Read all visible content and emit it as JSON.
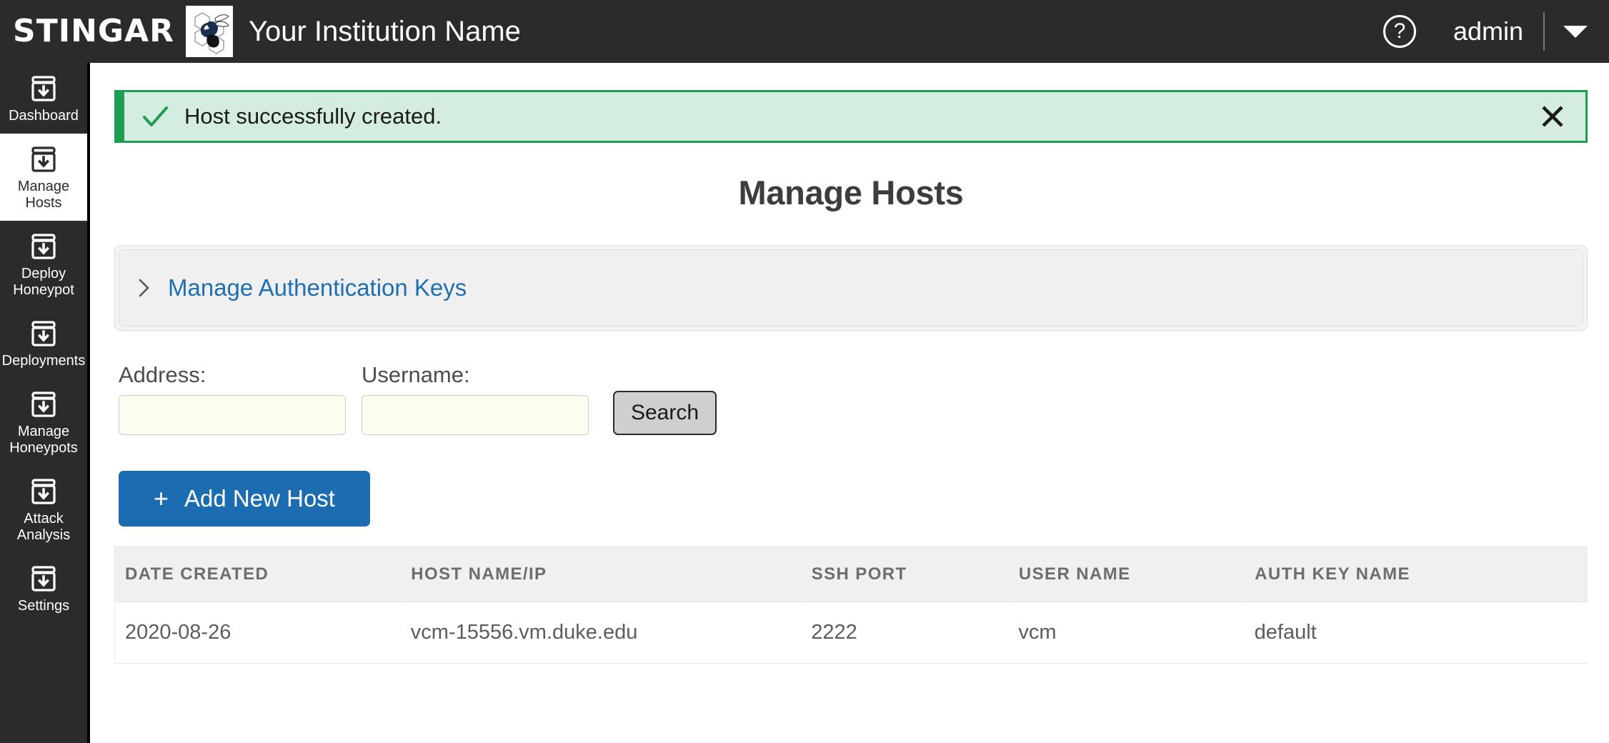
{
  "header": {
    "wordmark": "STINGAR",
    "logo_icon": "hornet-honeycomb-logo",
    "institution": "Your Institution Name",
    "help_icon": "question-mark-circle-icon",
    "user": "admin",
    "caret_icon": "chevron-down-icon",
    "bar_color": "#2b2b2b"
  },
  "sidebar": {
    "items": [
      {
        "label": "Dashboard",
        "icon": "archive-download-icon",
        "active": false
      },
      {
        "label": "Manage\nHosts",
        "icon": "archive-download-icon",
        "active": true
      },
      {
        "label": "Deploy\nHoneypot",
        "icon": "archive-download-icon",
        "active": false
      },
      {
        "label": "Deployments",
        "icon": "archive-download-icon",
        "active": false
      },
      {
        "label": "Manage\nHoneypots",
        "icon": "archive-download-icon",
        "active": false
      },
      {
        "label": "Attack\nAnalysis",
        "icon": "archive-download-icon",
        "active": false
      },
      {
        "label": "Settings",
        "icon": "archive-download-icon",
        "active": false
      }
    ]
  },
  "alert": {
    "message": "Host successfully created.",
    "icon": "check-mark-icon",
    "close_icon": "close-x-icon",
    "border_color": "#1e9e52",
    "background_color": "#d4ede0"
  },
  "main": {
    "page_title": "Manage Hosts",
    "accordion": {
      "label": "Manage Authentication Keys",
      "chevron_icon": "chevron-right-icon",
      "link_color": "#1f6fb2"
    },
    "search": {
      "address_label": "Address:",
      "address_value": "",
      "address_placeholder": "",
      "username_label": "Username:",
      "username_value": "",
      "username_placeholder": "",
      "search_button": "Search"
    },
    "add_host_button": {
      "label": "Add New Host",
      "plus_icon": "plus-icon",
      "color": "#1b6cb0"
    },
    "table": {
      "columns": [
        "DATE CREATED",
        "HOST NAME/IP",
        "SSH PORT",
        "USER NAME",
        "AUTH KEY NAME"
      ],
      "rows": [
        {
          "date_created": "2020-08-26",
          "host_name_ip": "vcm-15556.vm.duke.edu",
          "ssh_port": "2222",
          "user_name": "vcm",
          "auth_key_name": "default"
        }
      ]
    }
  }
}
